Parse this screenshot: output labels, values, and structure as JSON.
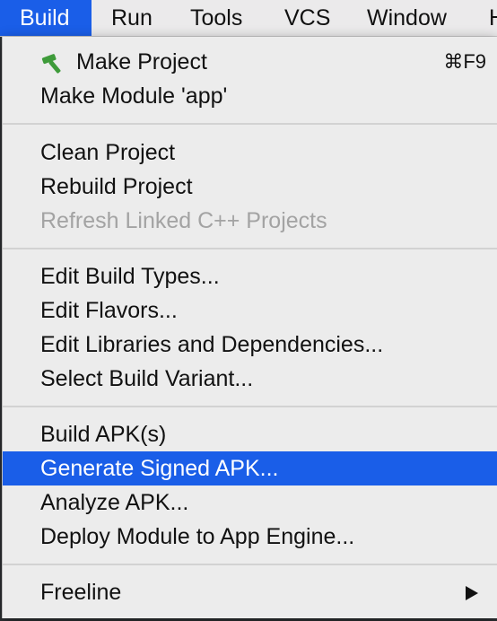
{
  "menubar": {
    "items": [
      "Build",
      "Run",
      "Tools",
      "VCS",
      "Window",
      "H"
    ]
  },
  "build_menu": {
    "group1": {
      "make_project": {
        "label": "Make Project",
        "shortcut": "⌘F9",
        "icon": "hammer-icon",
        "icon_color": "#3e9b3a"
      },
      "make_module": {
        "label": "Make Module 'app'"
      }
    },
    "group2": {
      "clean_project": {
        "label": "Clean Project"
      },
      "rebuild_project": {
        "label": "Rebuild Project"
      },
      "refresh_cpp": {
        "label": "Refresh Linked C++ Projects",
        "disabled": true
      }
    },
    "group3": {
      "edit_build_types": {
        "label": "Edit Build Types..."
      },
      "edit_flavors": {
        "label": "Edit Flavors..."
      },
      "edit_libraries": {
        "label": "Edit Libraries and Dependencies..."
      },
      "select_variant": {
        "label": "Select Build Variant..."
      }
    },
    "group4": {
      "build_apk": {
        "label": "Build APK(s)"
      },
      "generate_signed_apk": {
        "label": "Generate Signed APK...",
        "highlighted": true
      },
      "analyze_apk": {
        "label": "Analyze APK..."
      },
      "deploy_module": {
        "label": "Deploy Module to App Engine..."
      }
    },
    "group5": {
      "freeline": {
        "label": "Freeline",
        "has_submenu": true
      }
    }
  },
  "colors": {
    "highlight": "#1a5ee8",
    "menu_bg": "#ececec",
    "disabled_text": "#a3a3a3"
  }
}
